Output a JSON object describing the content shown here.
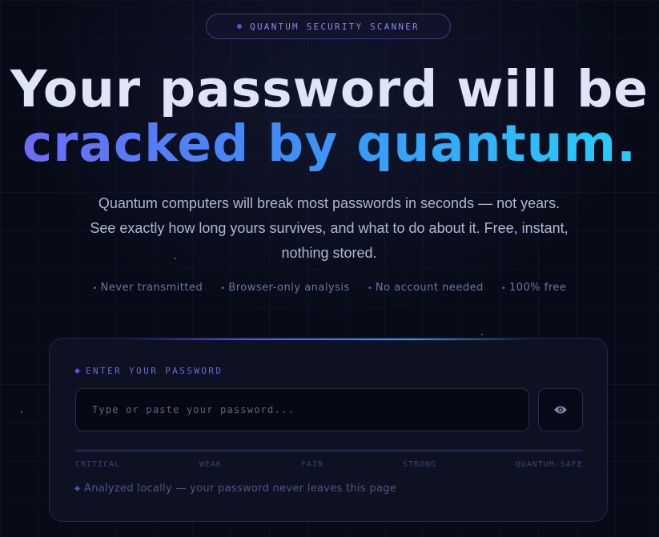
{
  "badge": {
    "label": "QUANTUM SECURITY SCANNER"
  },
  "hero": {
    "title_line1": "Your password will be",
    "title_line2": "cracked by quantum.",
    "subtitle": "Quantum computers will break most passwords in seconds — not years. See exactly how long yours survives, and what to do about it. Free, instant, nothing stored."
  },
  "features": [
    "Never transmitted",
    "Browser-only analysis",
    "No account needed",
    "100% free"
  ],
  "scanner": {
    "field_label": "ENTER YOUR PASSWORD",
    "input_value": "",
    "input_placeholder": "Type or paste your password...",
    "toggle_icon": "eye-icon",
    "strength_fraction": 0,
    "strength_levels": [
      "CRITICAL",
      "WEAK",
      "FAIR",
      "STRONG",
      "QUANTUM-SAFE"
    ],
    "privacy_note": "Analyzed locally — your password never leaves this page"
  },
  "colors": {
    "background": "#080b17",
    "accent_purple": "#6c6cf6",
    "accent_blue": "#3d8ff7",
    "accent_cyan": "#25d0f7"
  }
}
